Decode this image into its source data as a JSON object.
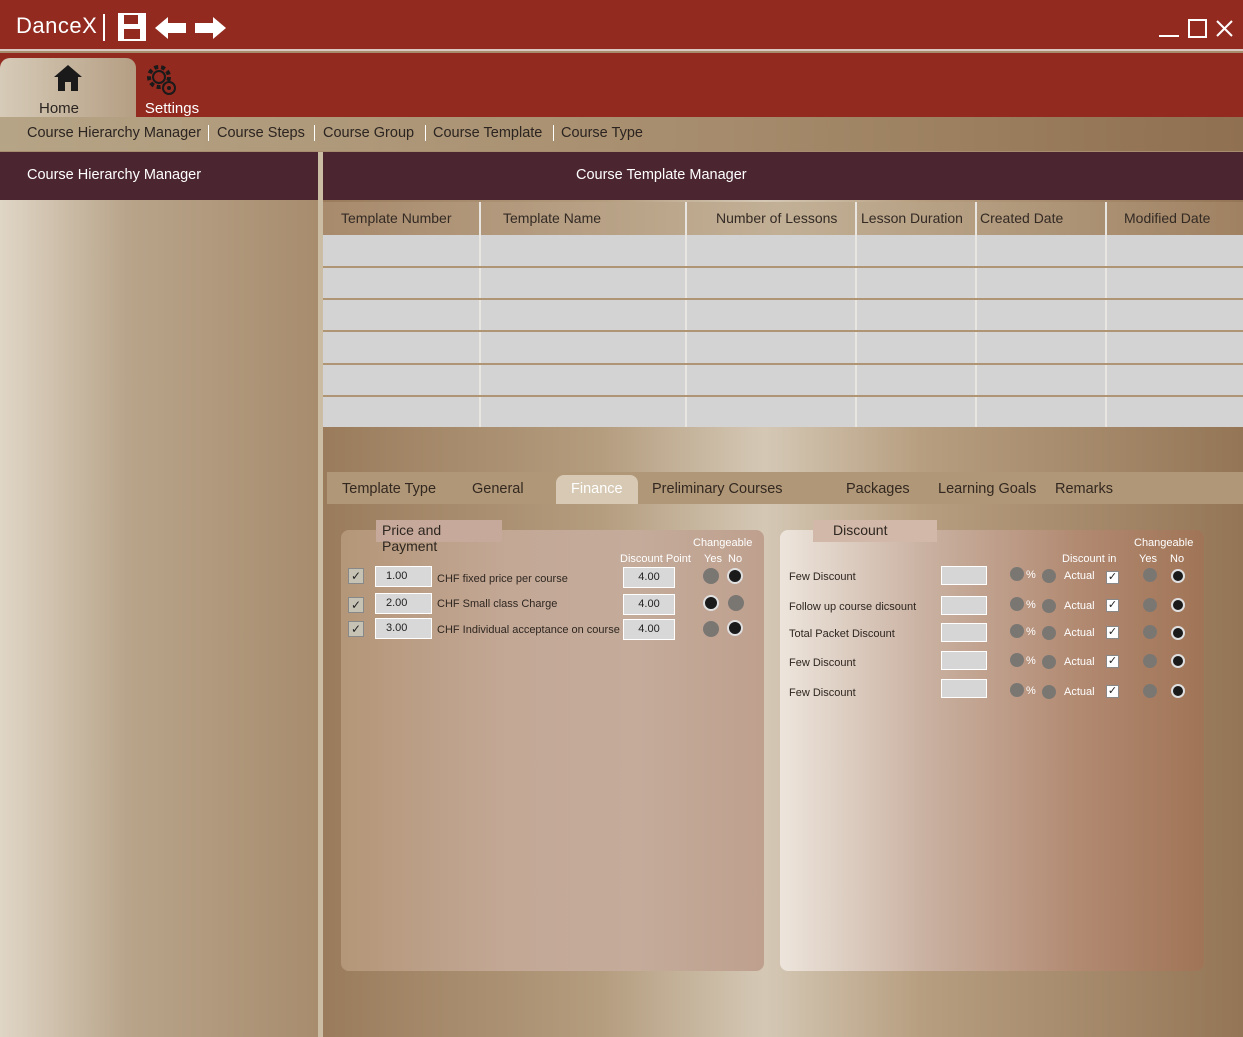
{
  "app": {
    "title": "DanceX"
  },
  "ribbon": {
    "home_label": "Home",
    "settings_label": "Settings"
  },
  "subnav": [
    "Course Hierarchy Manager",
    "Course Steps",
    "Course Group",
    "Course Template",
    "Course Type"
  ],
  "left_panel": {
    "title": "Course Hierarchy Manager"
  },
  "right_panel": {
    "title": "Course Template Manager"
  },
  "table": {
    "columns": [
      "Template Number",
      "Template Name",
      "Number of Lessons",
      "Lesson Duration",
      "Created Date",
      "Modified Date"
    ]
  },
  "tabs": [
    "Template Type",
    "General",
    "Finance",
    "Preliminary Courses",
    "Packages",
    "Learning Goals",
    "Remarks"
  ],
  "price": {
    "title": "Price and Payment",
    "changeable": "Changeable",
    "discount_point": "Discount Point",
    "yes": "Yes",
    "no": "No",
    "rows": [
      {
        "value": "1.00",
        "label": "CHF fixed price per course",
        "discount": "4.00"
      },
      {
        "value": "2.00",
        "label": "CHF Small class Charge",
        "discount": "4.00"
      },
      {
        "value": "3.00",
        "label": "CHF Individual acceptance on course",
        "discount": "4.00"
      }
    ]
  },
  "discount": {
    "title": "Discount",
    "changeable": "Changeable",
    "discount_in": "Discount in",
    "yes": "Yes",
    "no": "No",
    "percent": "%",
    "rows": [
      {
        "label": "Few Discount",
        "unit": "Actual"
      },
      {
        "label": "Follow up course dicsount",
        "unit": "Actual"
      },
      {
        "label": "Total Packet Discount",
        "unit": "Actual"
      },
      {
        "label": "Few Discount",
        "unit": "Actual"
      },
      {
        "label": "Few Discount",
        "unit": "Actual"
      }
    ]
  },
  "checkmark": "✓"
}
